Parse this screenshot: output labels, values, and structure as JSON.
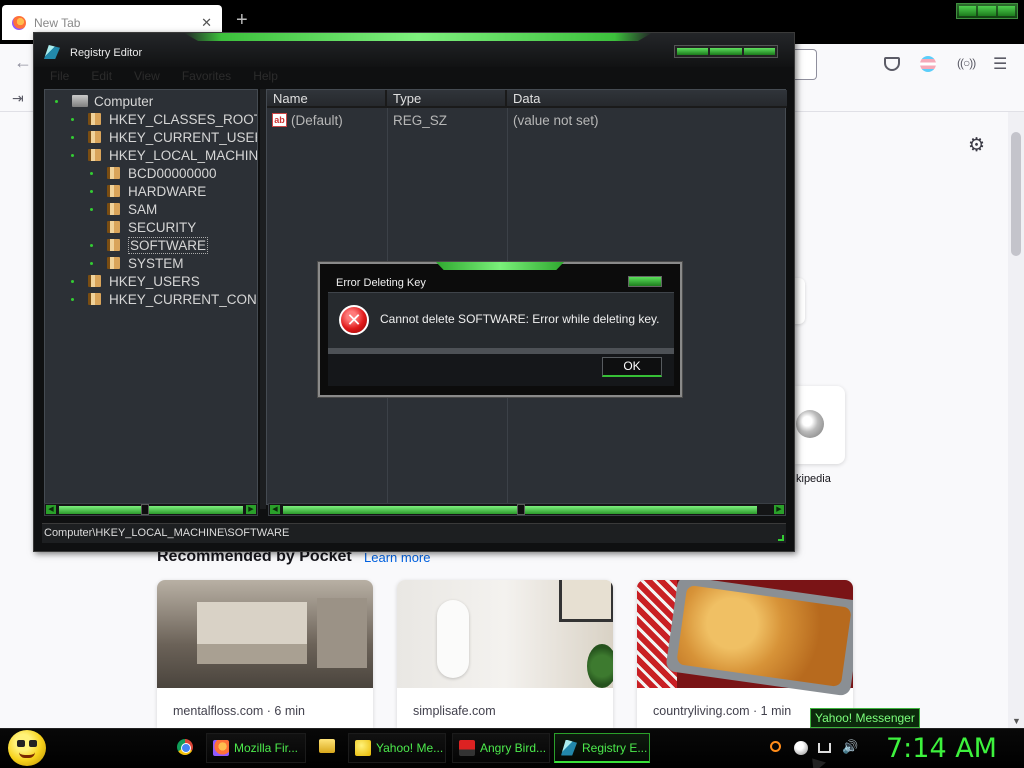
{
  "browser": {
    "tab_title": "New Tab",
    "tab_close": "✕",
    "new_tab": "+",
    "settings_icon": "⚙",
    "pocket": {
      "heading": "Recommended by Pocket",
      "learn_more": "Learn more",
      "cards": [
        {
          "source": "mentalfloss.com · 6 min"
        },
        {
          "source": "simplisafe.com"
        },
        {
          "source": "countryliving.com · 1 min"
        }
      ]
    },
    "shortcut_label": "kipedia"
  },
  "regedit": {
    "title": "Registry Editor",
    "menu": [
      "File",
      "Edit",
      "View",
      "Favorites",
      "Help"
    ],
    "tree": [
      {
        "label": "Computer",
        "level": 0,
        "type": "computer"
      },
      {
        "label": "HKEY_CLASSES_ROOT",
        "level": 1
      },
      {
        "label": "HKEY_CURRENT_USER",
        "level": 1
      },
      {
        "label": "HKEY_LOCAL_MACHINE",
        "level": 1
      },
      {
        "label": "BCD00000000",
        "level": 2
      },
      {
        "label": "HARDWARE",
        "level": 2
      },
      {
        "label": "SAM",
        "level": 2
      },
      {
        "label": "SECURITY",
        "level": 2
      },
      {
        "label": "SOFTWARE",
        "level": 2,
        "selected": true
      },
      {
        "label": "SYSTEM",
        "level": 2
      },
      {
        "label": "HKEY_USERS",
        "level": 1
      },
      {
        "label": "HKEY_CURRENT_CONFI",
        "level": 1
      }
    ],
    "columns": [
      "Name",
      "Type",
      "Data"
    ],
    "values": [
      {
        "name": "(Default)",
        "type": "REG_SZ",
        "data": "(value not set)",
        "icon": "ab"
      }
    ],
    "status_path": "Computer\\HKEY_LOCAL_MACHINE\\SOFTWARE"
  },
  "dialog": {
    "title": "Error Deleting Key",
    "message": "Cannot delete SOFTWARE:  Error while deleting key.",
    "ok_label": "OK",
    "error_glyph": "✕"
  },
  "taskbar": {
    "buttons": [
      {
        "label": "Mozilla Fir...",
        "icon": "firefox-icon"
      },
      {
        "label": "Yahoo! Me...",
        "icon": "yahoo-icon"
      },
      {
        "label": "Angry Bird...",
        "icon": "angry-birds-icon"
      },
      {
        "label": "Registry E...",
        "icon": "registry-icon",
        "active": true
      }
    ],
    "clock": "7:14 AM",
    "tooltip": "Yahoo! Messenger",
    "volume_glyph": "🔊"
  },
  "colors": {
    "accent_green": "#3cc03c",
    "dialog_bg": "#262a2e",
    "tree_bg": "#2c3036"
  }
}
